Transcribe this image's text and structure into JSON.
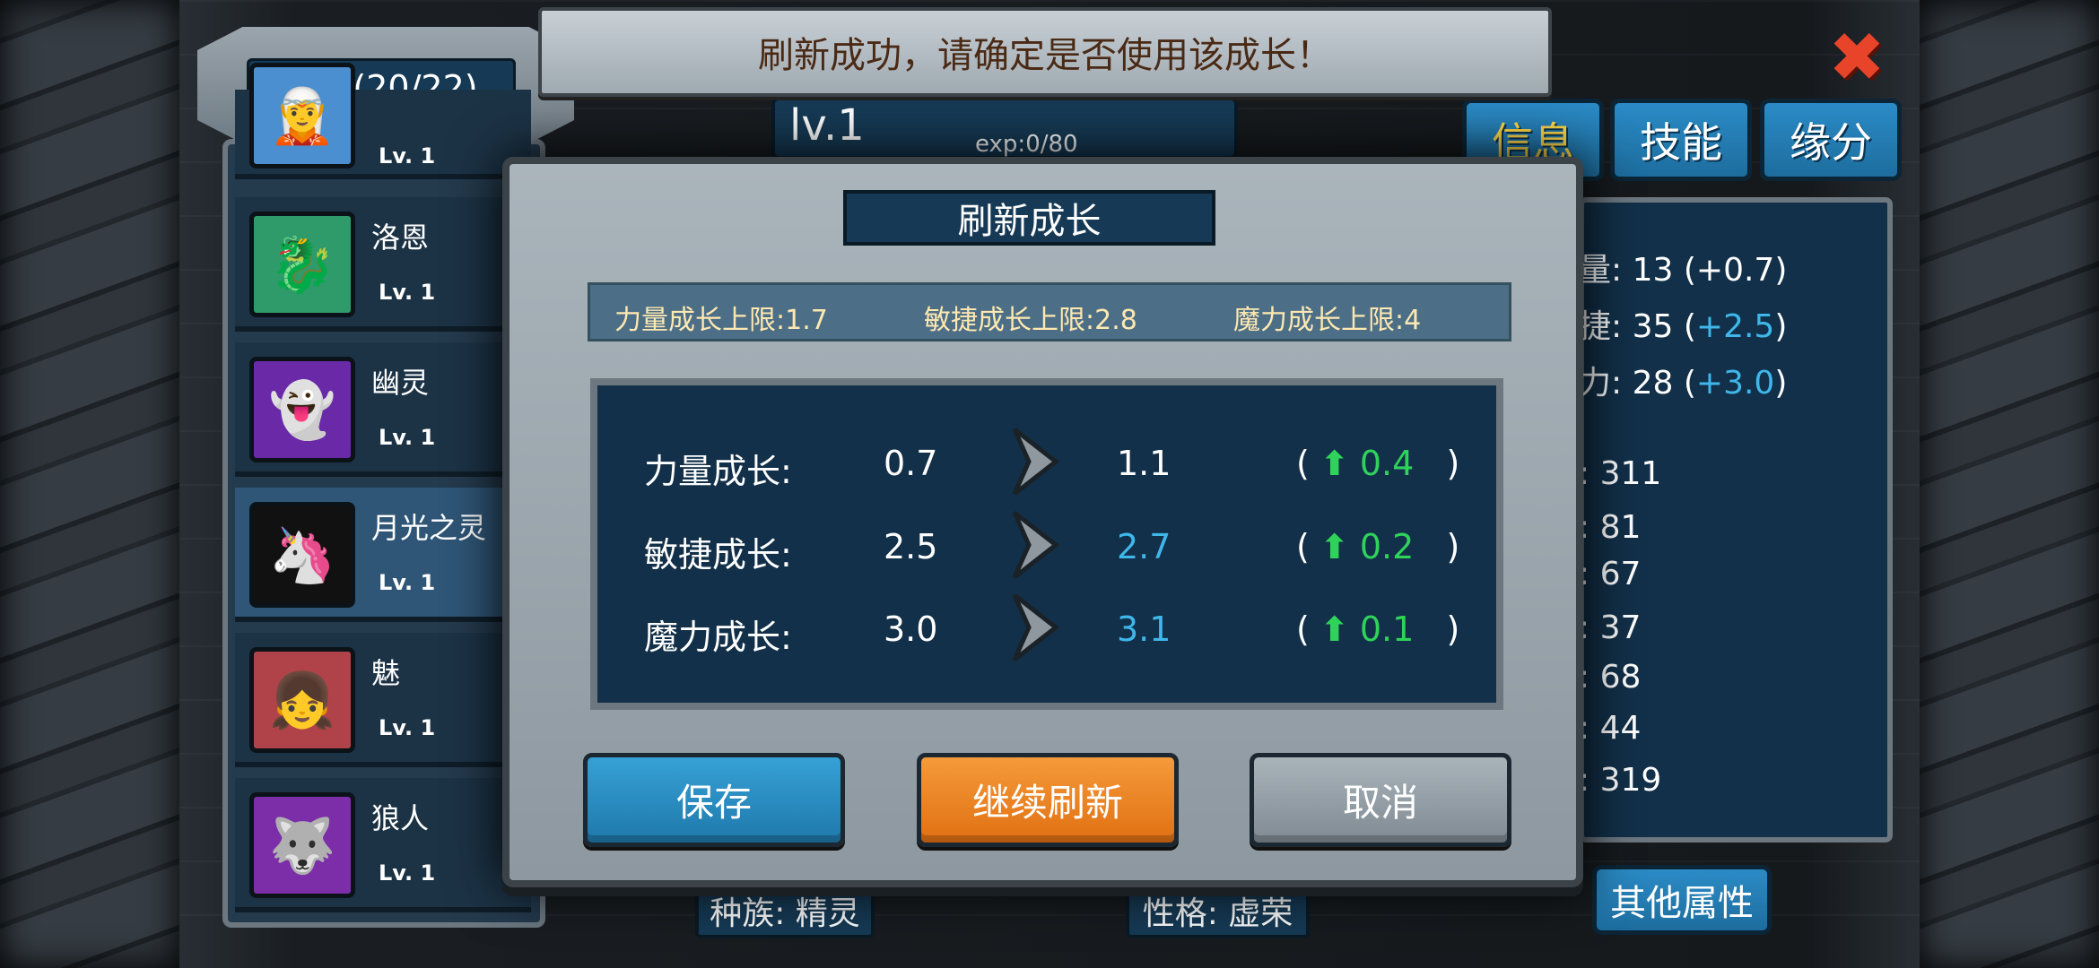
{
  "notice": {
    "text": "刷新成功，请确定是否使用该成长！"
  },
  "close_button": {
    "icon": "close-icon"
  },
  "creature_list": {
    "title": "生物(20/22)",
    "items": [
      {
        "name": "",
        "level": "Lv. 1",
        "portrait": "blue-hair-portrait"
      },
      {
        "name": "洛恩",
        "level": "Lv. 1",
        "portrait": "green-dragon-portrait"
      },
      {
        "name": "幽灵",
        "level": "Lv. 1",
        "portrait": "ghost-portrait"
      },
      {
        "name": "月光之灵",
        "level": "Lv. 1",
        "portrait": "moonlight-spirit-portrait",
        "selected": true
      },
      {
        "name": "魅",
        "level": "Lv. 1",
        "portrait": "charm-girl-portrait"
      },
      {
        "name": "狼人",
        "level": "Lv. 1",
        "portrait": "werewolf-portrait"
      }
    ]
  },
  "detail": {
    "level": "lv.1",
    "exp": "exp:0/80",
    "tabs": [
      {
        "label": "信息",
        "active": true
      },
      {
        "label": "技能",
        "active": false
      },
      {
        "label": "缘分",
        "active": false
      }
    ],
    "stats_top": [
      {
        "label": "量:",
        "value": "13",
        "bonus": "+0.7"
      },
      {
        "label": "捷:",
        "value": "35",
        "bonus": "+2.5"
      },
      {
        "label": "力:",
        "value": "28",
        "bonus": "+3.0"
      }
    ],
    "stats_bottom": [
      {
        "label": ":",
        "value": "311"
      },
      {
        "label": ":",
        "value": "81"
      },
      {
        "label": ":",
        "value": "67"
      },
      {
        "label": ":",
        "value": "37"
      },
      {
        "label": ":",
        "value": "68"
      },
      {
        "label": ":",
        "value": "44"
      },
      {
        "label": ":",
        "value": "319"
      }
    ],
    "other_attributes_button": "其他属性",
    "race": "种族: 精灵",
    "personality": "性格: 虚荣"
  },
  "dialog": {
    "title": "刷新成长",
    "limits": [
      "力量成长上限:1.7",
      "敏捷成长上限:2.8",
      "魔力成长上限:4"
    ],
    "rows": [
      {
        "label": "力量成长:",
        "old": "0.7",
        "new": "1.1",
        "delta": "0.4",
        "new_highlight": false
      },
      {
        "label": "敏捷成长:",
        "old": "2.5",
        "new": "2.7",
        "delta": "0.2",
        "new_highlight": true
      },
      {
        "label": "魔力成长:",
        "old": "3.0",
        "new": "3.1",
        "delta": "0.1",
        "new_highlight": true
      }
    ],
    "buttons": {
      "save": "保存",
      "refresh": "继续刷新",
      "cancel": "取消"
    }
  },
  "colors": {
    "panel_blue": "#123049",
    "accent_blue": "#3fb7ea",
    "increase_green": "#2fd35a",
    "refresh_orange": "#e07012",
    "active_tab_yellow": "#ffd94a"
  }
}
